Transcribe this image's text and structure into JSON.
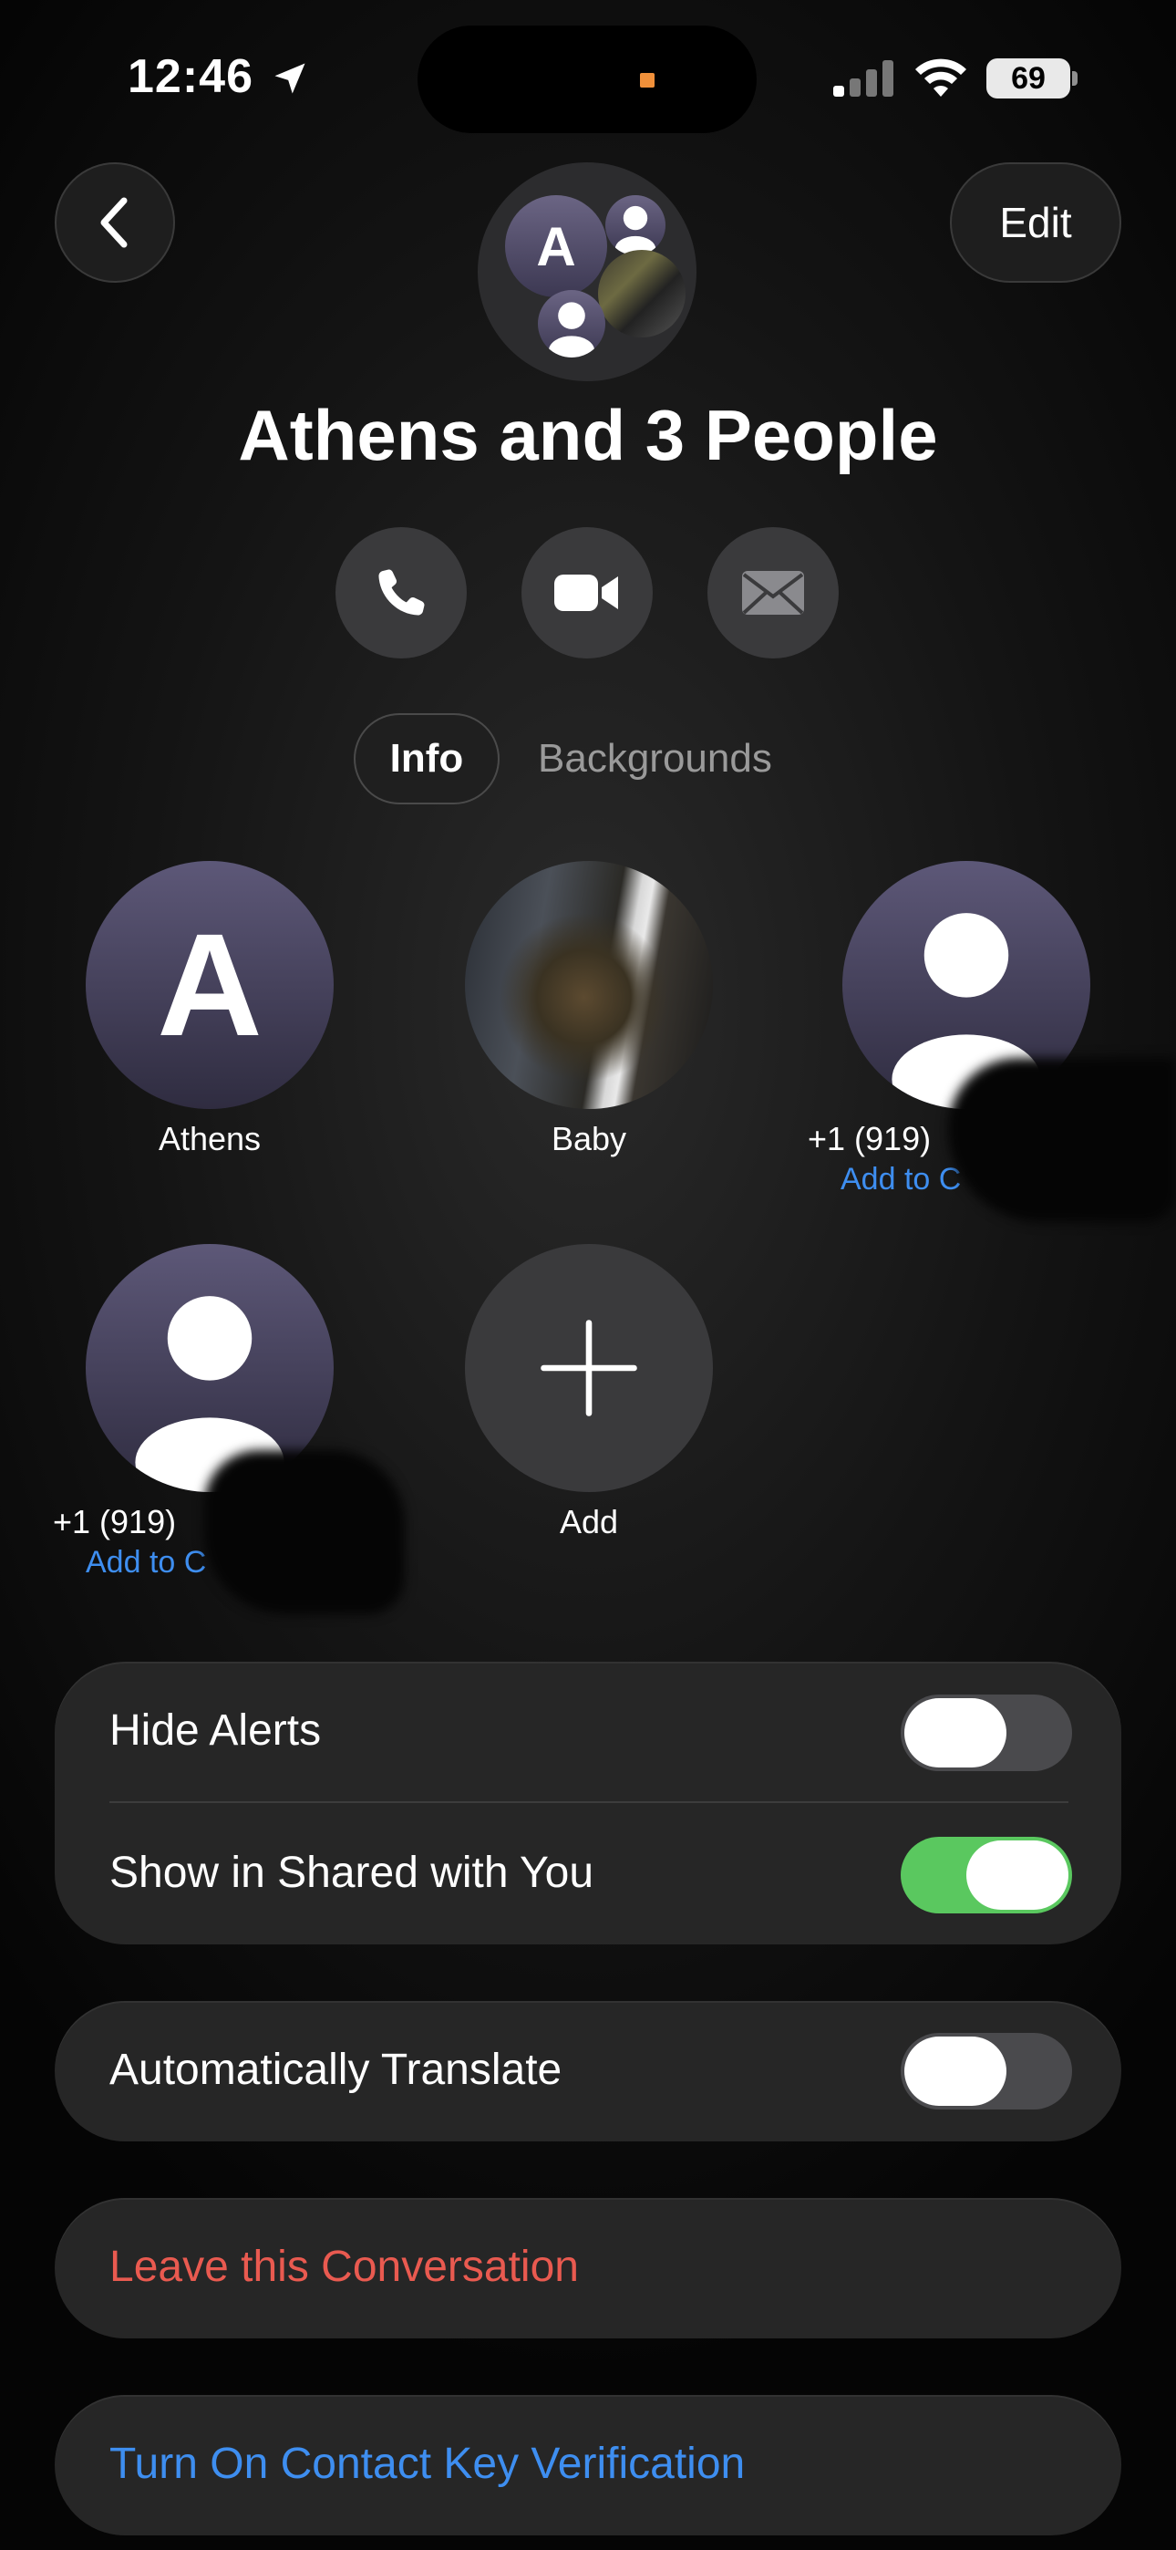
{
  "status_bar": {
    "time": "12:46",
    "battery": "69"
  },
  "header": {
    "edit_label": "Edit",
    "group_avatar_initial": "A",
    "title": "Athens and 3 People"
  },
  "actions": {
    "call_icon": "phone-icon",
    "video_icon": "video-icon",
    "mail_icon": "mail-icon"
  },
  "tabs": {
    "info": "Info",
    "backgrounds": "Backgrounds"
  },
  "members": [
    {
      "name": "Athens",
      "initial": "A"
    },
    {
      "name": "Baby"
    },
    {
      "name": "+1 (919) ",
      "sub": "Add to C"
    },
    {
      "name": "+1 (919)",
      "sub": "Add to C"
    },
    {
      "name": "Add"
    }
  ],
  "settings": {
    "hide_alerts": {
      "label": "Hide Alerts",
      "on": false
    },
    "shared_with_you": {
      "label": "Show in Shared with You",
      "on": true
    },
    "auto_translate": {
      "label": "Automatically Translate",
      "on": false
    },
    "leave": "Leave this Conversation",
    "key_verification": "Turn On Contact Key Verification"
  },
  "colors": {
    "accent_blue": "#3e8ef0",
    "destructive_red": "#e95a50",
    "toggle_on": "#5ac85f"
  }
}
